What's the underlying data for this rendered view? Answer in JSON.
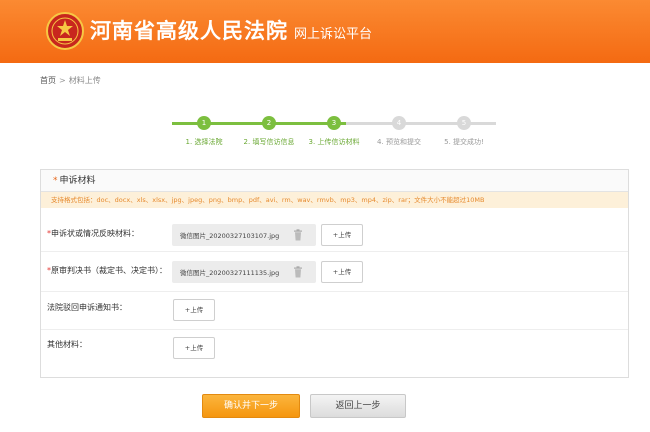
{
  "header": {
    "title": "河南省高级人民法院",
    "subtitle": "网上诉讼平台",
    "emblem_icon": "court-emblem-icon"
  },
  "breadcrumb": {
    "home": "首页",
    "separator": ">",
    "current": "材料上传"
  },
  "steps": [
    {
      "number": "1",
      "label": "1. 选择法院",
      "state": "done"
    },
    {
      "number": "2",
      "label": "2. 填写信访信息",
      "state": "done"
    },
    {
      "number": "3",
      "label": "3. 上传信访材料",
      "state": "current"
    },
    {
      "number": "4",
      "label": "4. 预览和提交",
      "state": "todo"
    },
    {
      "number": "5",
      "label": "5. 提交成功!",
      "state": "todo"
    }
  ],
  "panel": {
    "star": "*",
    "title": "申诉材料",
    "notice": "支持格式包括：doc、docx、xls、xlsx、jpg、jpeg、png、bmp、pdf、avi、rm、wav、rmvb、mp3、mp4、zip、rar；文件大小不能超过10MB"
  },
  "rows": [
    {
      "required": "*",
      "label": "申诉状或情况反映材料：",
      "file": "微信图片_20200327103107.jpg",
      "upload": "+上传"
    },
    {
      "required": "*",
      "label": "原审判决书（裁定书、决定书）：",
      "file": "微信图片_20200327111135.jpg",
      "upload": "+上传"
    },
    {
      "required": "",
      "label": "法院驳回申诉通知书：",
      "upload": "+上传"
    },
    {
      "required": "",
      "label": "其他材料：",
      "upload": "+上传"
    }
  ],
  "actions": {
    "confirm": "确认并下一步",
    "back": "返回上一步"
  },
  "colors": {
    "header": "#f47a1f",
    "step_done": "#7cbf3f",
    "step_todo": "#d9d9d9",
    "notice_bg": "#fdf0d9",
    "confirm_button": "#f5a524"
  }
}
